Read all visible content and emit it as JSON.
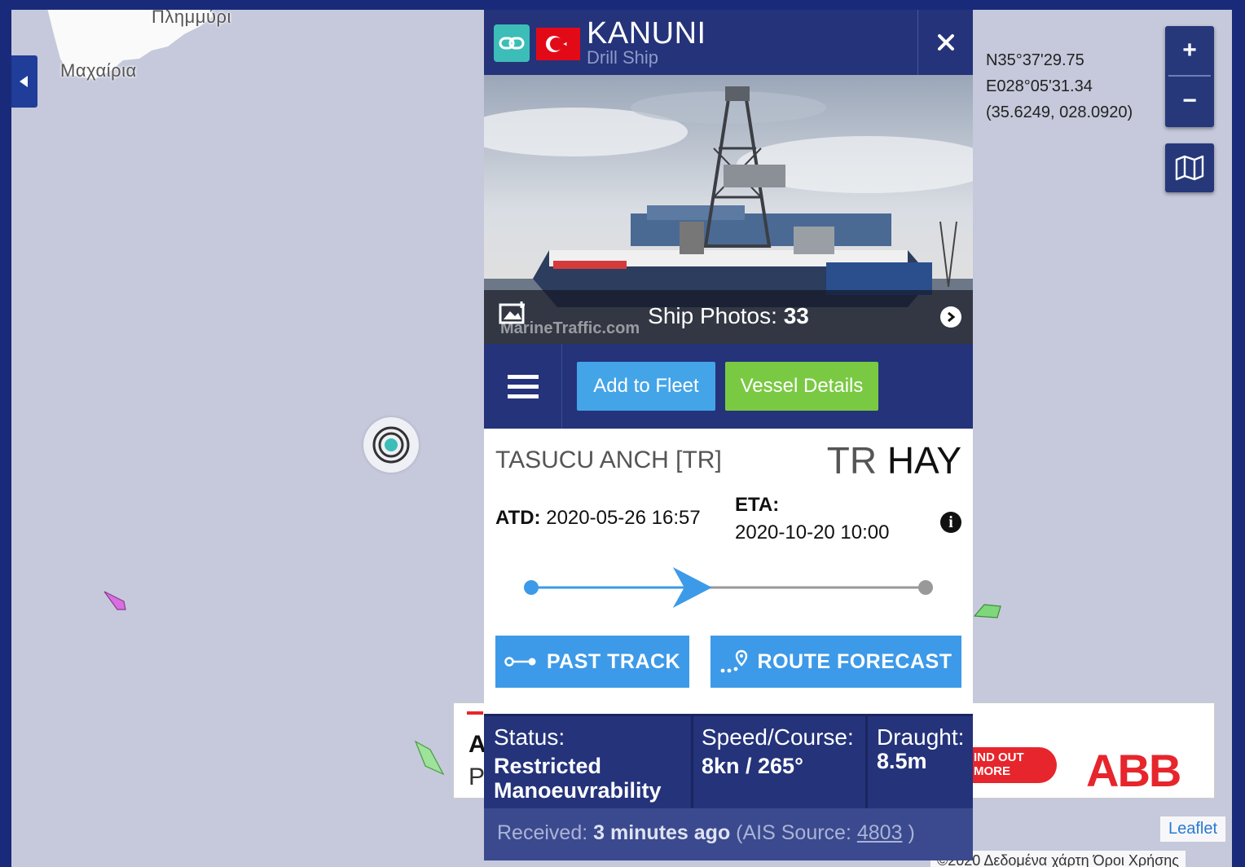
{
  "map": {
    "labels": [
      "Πλημμύρι",
      "Μαχαίρια"
    ],
    "coords": {
      "lat": "N35°37'29.75",
      "lon": "E028°05'31.34",
      "decimal": "(35.6249, 028.0920)"
    },
    "zoom_in_label": "+",
    "zoom_out_label": "−",
    "leaflet": "Leaflet",
    "attribution": "©2020 Δεδομένα χάρτη   Όροι Χρήσης"
  },
  "ad": {
    "headline_fragment": "A",
    "sub_fragment": "P",
    "cta": "IND OUT\nMORE",
    "logo": "ABB",
    "brand_color": "#e6262c"
  },
  "vessel": {
    "name": "KANUNI",
    "type": "Drill Ship",
    "flag": "Turkey",
    "photos_label": "Ship Photos:",
    "photos_count": "33",
    "photo_credit": "MarineTraffic.com"
  },
  "actions": {
    "add_to_fleet": "Add to Fleet",
    "vessel_details": "Vessel Details"
  },
  "voyage": {
    "from": "TASUCU ANCH [TR]",
    "to_country": "TR",
    "to_port": "HAY",
    "atd_label": "ATD:",
    "atd_value": "2020-05-26 16:57",
    "eta_label": "ETA:",
    "eta_value": "2020-10-20 10:00",
    "progress": 0.45
  },
  "track_buttons": {
    "past_track": "PAST TRACK",
    "route_forecast": "ROUTE FORECAST"
  },
  "stats": {
    "status_label": "Status:",
    "status_value": "Restricted Manoeuvrability",
    "speed_label": "Speed/Course:",
    "speed_value": "8kn / 265°",
    "draught_label": "Draught:",
    "draught_value": "8.5m"
  },
  "received": {
    "label": "Received:",
    "value": "3 minutes ago",
    "source_prefix": "(AIS Source:",
    "source_id": "4803",
    "source_suffix": ")"
  },
  "colors": {
    "header_navy": "#24337a",
    "button_blue": "#3d9ae8",
    "fleet_blue": "#44a4e8",
    "details_green": "#7ac943",
    "map_water": "#c5c9db"
  }
}
